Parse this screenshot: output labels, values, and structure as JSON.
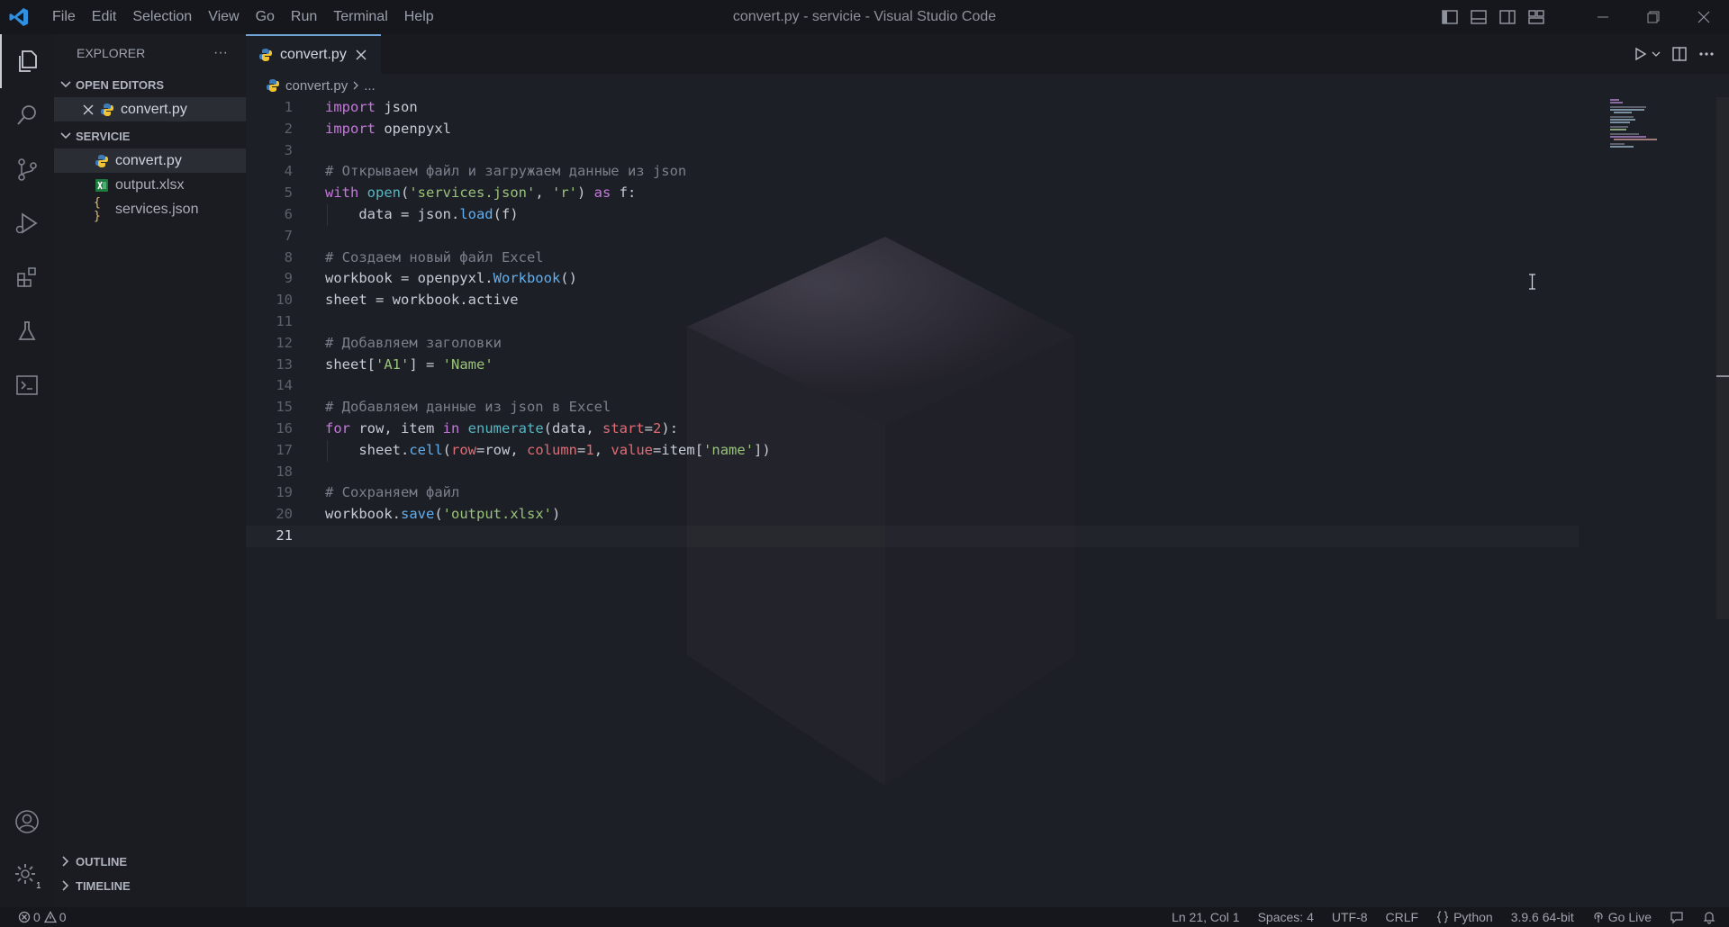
{
  "titlebar": {
    "menu": [
      "File",
      "Edit",
      "Selection",
      "View",
      "Go",
      "Run",
      "Terminal",
      "Help"
    ],
    "window_title": "convert.py - servicie - Visual Studio Code"
  },
  "activity_bar": {
    "icons": [
      "files-icon",
      "search-icon",
      "source-control-icon",
      "run-debug-icon",
      "extensions-icon",
      "testing-icon",
      "terminal-icon"
    ],
    "bottom_icons": [
      "account-icon",
      "settings-gear-icon"
    ],
    "settings_badge": "1"
  },
  "sidebar": {
    "title": "EXPLORER",
    "more_label": "···",
    "open_editors_label": "OPEN EDITORS",
    "open_editors": [
      {
        "name": "convert.py",
        "icon": "python-file-icon"
      }
    ],
    "folder_label": "SERVICIE",
    "files": [
      {
        "name": "convert.py",
        "icon": "python-file-icon"
      },
      {
        "name": "output.xlsx",
        "icon": "excel-file-icon"
      },
      {
        "name": "services.json",
        "icon": "json-file-icon"
      }
    ],
    "outline_label": "OUTLINE",
    "timeline_label": "TIMELINE"
  },
  "editor": {
    "tab_label": "convert.py",
    "breadcrumb": {
      "file": "convert.py",
      "rest": "..."
    },
    "code_lines": [
      "import json",
      "import openpyxl",
      "",
      "# Открываем файл и загружаем данные из json",
      "with open('services.json', 'r') as f:",
      "    data = json.load(f)",
      "",
      "# Создаем новый файл Excel",
      "workbook = openpyxl.Workbook()",
      "sheet = workbook.active",
      "",
      "# Добавляем заголовки",
      "sheet['A1'] = 'Name'",
      "",
      "# Добавляем данные из json в Excel",
      "for row, item in enumerate(data, start=2):",
      "    sheet.cell(row=row, column=1, value=item['name'])",
      "",
      "# Сохраняем файл",
      "workbook.save('output.xlsx')",
      ""
    ],
    "current_line": 21
  },
  "statusbar": {
    "errors": "0",
    "warnings": "0",
    "position": "Ln 21, Col 1",
    "spaces": "Spaces: 4",
    "encoding": "UTF-8",
    "eol": "CRLF",
    "language": "Python",
    "interpreter": "3.9.6 64-bit",
    "go_live": "Go Live"
  },
  "colors": {
    "keyword": "#c678dd",
    "function": "#61afef",
    "string": "#98c379",
    "comment": "#7a7f8a",
    "number": "#e06c75",
    "tab_accent": "#6fa3d6"
  }
}
